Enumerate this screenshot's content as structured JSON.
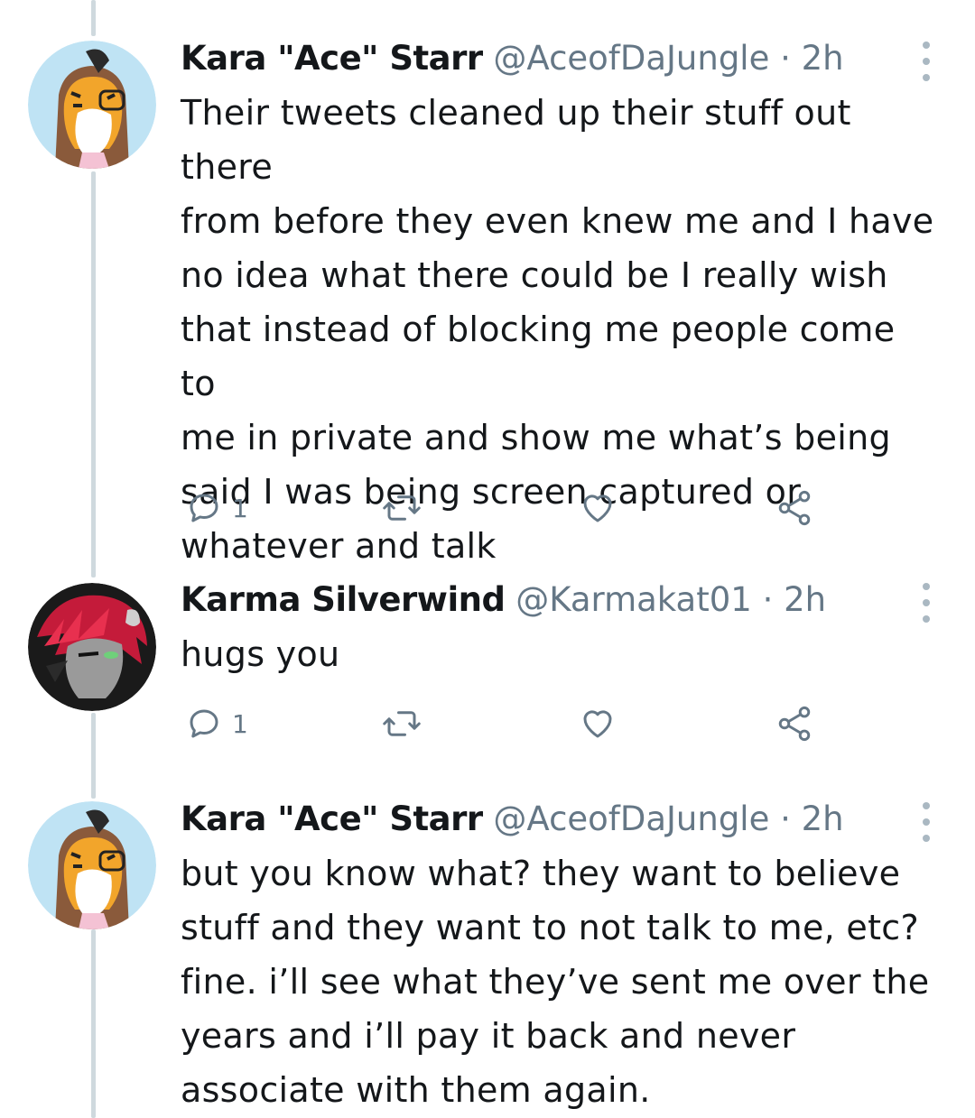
{
  "tweets": [
    {
      "name": "Kara \"Ace\" Starr",
      "handle": "@AceofDaJungle",
      "separator": "·",
      "time": "2h",
      "text": "Their tweets cleaned up their stuff out there\nfrom before they even knew me and I have\nno idea what there could be I really wish\nthat instead of blocking me people come to\nme in private and show me what’s being\nsaid I was being screen captured or\nwhatever and talk",
      "reply_count": "1",
      "avatar_icon": "tiger-avatar-icon"
    },
    {
      "name": "Karma Silverwind",
      "handle": "@Karmakat01",
      "separator": "·",
      "time": "2h",
      "text": "hugs you",
      "reply_count": "1",
      "avatar_icon": "dark-haired-character-avatar-icon"
    },
    {
      "name": "Kara \"Ace\" Starr",
      "handle": "@AceofDaJungle",
      "separator": "·",
      "time": "2h",
      "text": "but you know what? they want to believe\nstuff and they want to not talk to me, etc?\nfine. i’ll see what they’ve sent me over the\nyears and i’ll pay it back and never\nassociate with them again.",
      "avatar_icon": "tiger-avatar-icon"
    }
  ],
  "colors": {
    "text": "#14171a",
    "secondary": "#657786",
    "thread_line": "#cfd9de",
    "icon": "#657786"
  }
}
